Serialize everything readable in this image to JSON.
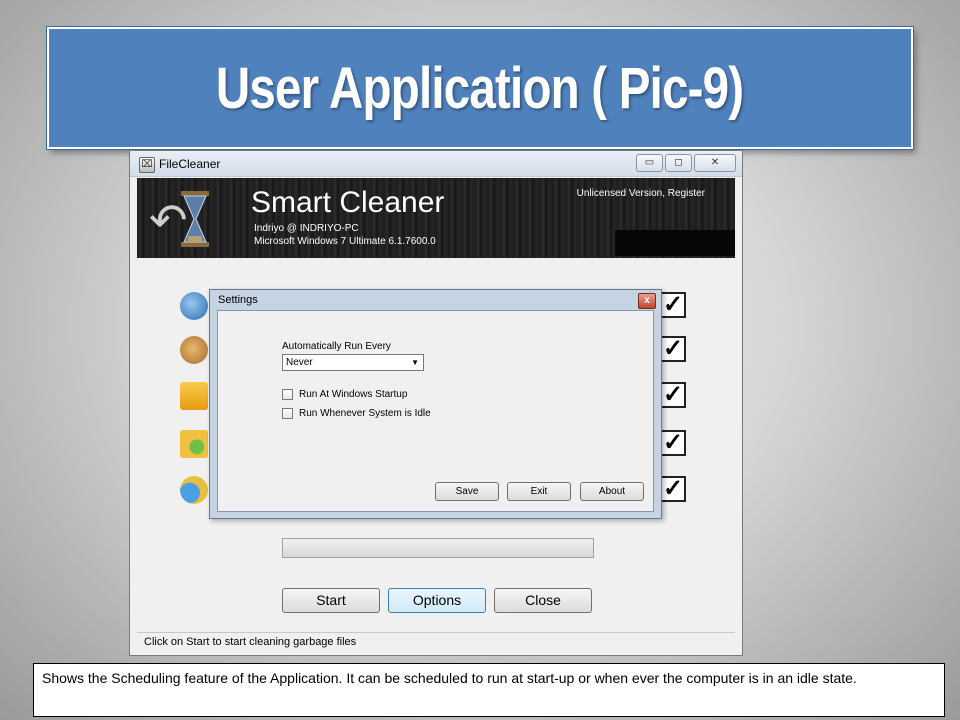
{
  "slide": {
    "title": "User Application ( Pic-9)",
    "caption": "Shows the Scheduling feature of the Application. It can be scheduled to run at start-up or when ever the computer is in an idle state."
  },
  "window": {
    "title": "FileCleaner",
    "controls": {
      "minimize": "▭",
      "maximize": "◻",
      "close": "✕"
    }
  },
  "header": {
    "app_name": "Smart Cleaner",
    "user_line": "Indriyo @ INDRIYO-PC",
    "os_line": "Microsoft Windows 7 Ultimate 6.1.7600.0",
    "license_link": "Unlicensed Version, Register"
  },
  "rows": [
    {
      "icon": "internet-explorer-icon",
      "checked": true,
      "mark": "✓"
    },
    {
      "icon": "cookie-icon",
      "checked": true,
      "mark": "✓"
    },
    {
      "icon": "recent-folder-icon",
      "checked": true,
      "mark": "✓"
    },
    {
      "icon": "history-folder-icon",
      "checked": true,
      "mark": "✓"
    },
    {
      "icon": "temp-files-icon",
      "checked": true,
      "mark": "✓"
    }
  ],
  "buttons": {
    "start": "Start",
    "options": "Options",
    "close": "Close"
  },
  "status_bar": "Click on Start to start cleaning garbage files",
  "settings_dialog": {
    "title": "Settings",
    "close_glyph": "x",
    "run_every_label": "Automatically Run Every",
    "run_every_value": "Never",
    "dropdown_arrow": "▼",
    "run_at_startup": {
      "label": "Run At Windows Startup",
      "checked": false
    },
    "run_when_idle": {
      "label": "Run Whenever System is Idle",
      "checked": false
    },
    "buttons": {
      "save": "Save",
      "exit": "Exit",
      "about": "About"
    }
  },
  "colors": {
    "banner": "#4f81bd",
    "header_bg": "#1e1e1e",
    "dialog_frame": "#c6d3e3"
  }
}
